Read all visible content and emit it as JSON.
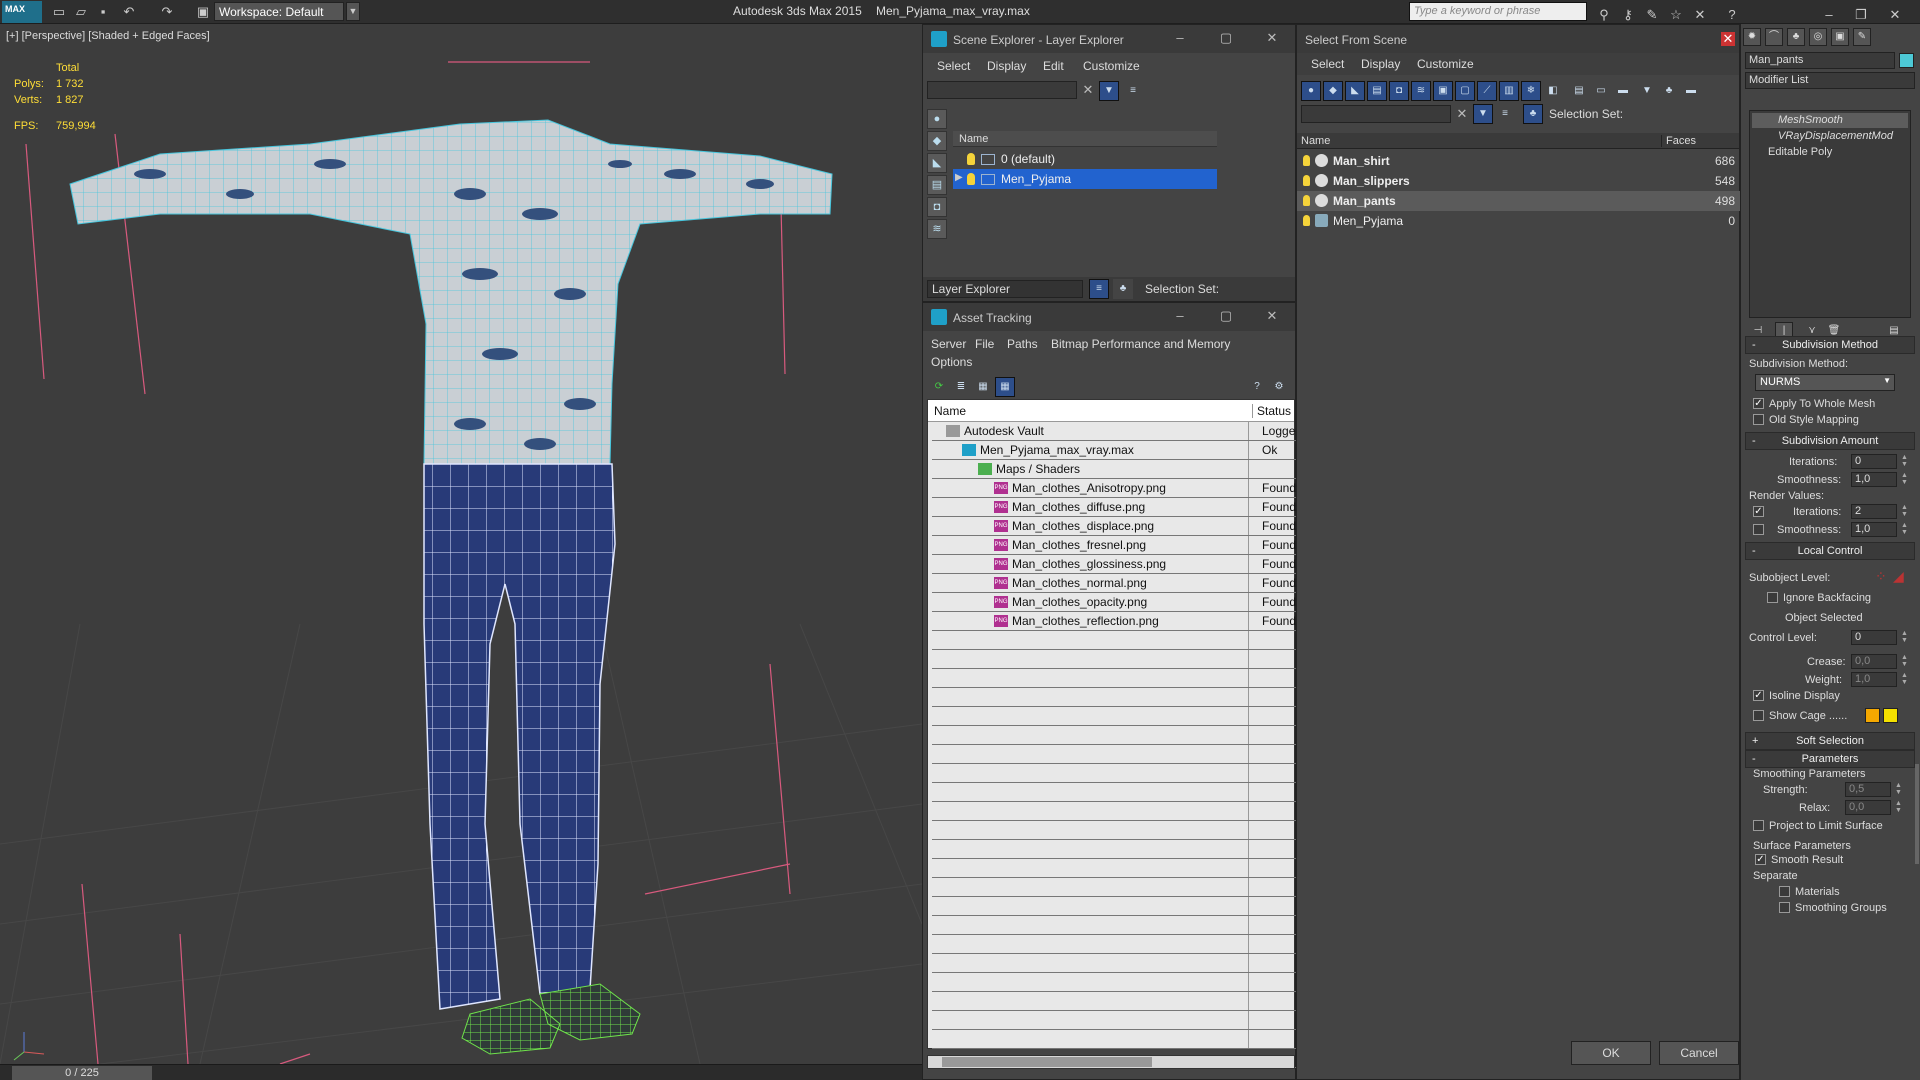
{
  "top_bar": {
    "workspace_label": "Workspace: Default",
    "app_title": "Autodesk 3ds Max  2015",
    "file_title": "Men_Pyjama_max_vray.max",
    "search_placeholder": "Type a keyword or phrase"
  },
  "viewport": {
    "label": "[+] [Perspective] [Shaded + Edged Faces]",
    "stats": {
      "total_label": "Total",
      "polys_label": "Polys:",
      "polys_value": "1 732",
      "verts_label": "Verts:",
      "verts_value": "1 827",
      "fps_label": "FPS:",
      "fps_value": "759,994"
    },
    "time_slider": "0 / 225"
  },
  "scene_explorer": {
    "title": "Scene Explorer - Layer Explorer",
    "menu": [
      "Select",
      "Display",
      "Edit",
      "Customize"
    ],
    "column_name": "Name",
    "layers": [
      {
        "name": "0 (default)",
        "selected": false
      },
      {
        "name": "Men_Pyjama",
        "selected": true
      }
    ],
    "footer_dropdown": "Layer Explorer",
    "selection_set_label": "Selection Set:"
  },
  "asset_tracking": {
    "title": "Asset Tracking",
    "menu": [
      "Server",
      "File",
      "Paths",
      "Bitmap Performance and Memory",
      "Options"
    ],
    "col_name": "Name",
    "col_status": "Status",
    "rows": [
      {
        "name": "Autodesk Vault",
        "status": "Logged",
        "indent": 0,
        "icon": "vault-icon"
      },
      {
        "name": "Men_Pyjama_max_vray.max",
        "status": "Ok",
        "indent": 1,
        "icon": "max-file-icon"
      },
      {
        "name": "Maps / Shaders",
        "status": "",
        "indent": 2,
        "icon": "maps-icon"
      },
      {
        "name": "Man_clothes_Anisotropy.png",
        "status": "Found",
        "indent": 3,
        "icon": "png-icon"
      },
      {
        "name": "Man_clothes_diffuse.png",
        "status": "Found",
        "indent": 3,
        "icon": "png-icon"
      },
      {
        "name": "Man_clothes_displace.png",
        "status": "Found",
        "indent": 3,
        "icon": "png-icon"
      },
      {
        "name": "Man_clothes_fresnel.png",
        "status": "Found",
        "indent": 3,
        "icon": "png-icon"
      },
      {
        "name": "Man_clothes_glossiness.png",
        "status": "Found",
        "indent": 3,
        "icon": "png-icon"
      },
      {
        "name": "Man_clothes_normal.png",
        "status": "Found",
        "indent": 3,
        "icon": "png-icon"
      },
      {
        "name": "Man_clothes_opacity.png",
        "status": "Found",
        "indent": 3,
        "icon": "png-icon"
      },
      {
        "name": "Man_clothes_reflection.png",
        "status": "Found",
        "indent": 3,
        "icon": "png-icon"
      }
    ]
  },
  "select_from_scene": {
    "title": "Select From Scene",
    "menu": [
      "Select",
      "Display",
      "Customize"
    ],
    "selection_set_label": "Selection Set:",
    "col_name": "Name",
    "col_faces": "Faces",
    "objects": [
      {
        "name": "Man_shirt",
        "faces": "686",
        "selected": false,
        "bold": true
      },
      {
        "name": "Man_slippers",
        "faces": "548",
        "selected": false,
        "bold": true
      },
      {
        "name": "Man_pants",
        "faces": "498",
        "selected": true,
        "bold": true
      },
      {
        "name": "Men_Pyjama",
        "faces": "0",
        "selected": false,
        "bold": false
      }
    ],
    "ok_label": "OK",
    "cancel_label": "Cancel"
  },
  "command_panel": {
    "object_name": "Man_pants",
    "object_color": "#4dc9d6",
    "modifier_list_label": "Modifier List",
    "modifier_stack": [
      "MeshSmooth",
      "VRayDisplacementMod",
      "Editable Poly"
    ],
    "subdivision_method": {
      "title": "Subdivision Method",
      "method_label": "Subdivision Method:",
      "method_value": "NURMS",
      "apply_whole_mesh": "Apply To Whole Mesh",
      "old_style_mapping": "Old Style Mapping"
    },
    "subdivision_amount": {
      "title": "Subdivision Amount",
      "iterations_label": "Iterations:",
      "iterations_value": "0",
      "smoothness_label": "Smoothness:",
      "smoothness_value": "1,0",
      "render_values_label": "Render Values:",
      "render_iterations_label": "Iterations:",
      "render_iterations_value": "2",
      "render_smoothness_label": "Smoothness:",
      "render_smoothness_value": "1,0"
    },
    "local_control": {
      "title": "Local Control",
      "subobject_label": "Subobject Level:",
      "ignore_backfacing": "Ignore Backfacing",
      "object_selected": "Object Selected",
      "control_level_label": "Control Level:",
      "control_level_value": "0",
      "crease_label": "Crease:",
      "crease_value": "0,0",
      "weight_label": "Weight:",
      "weight_value": "1,0",
      "isoline_display": "Isoline Display",
      "show_cage": "Show Cage ......",
      "cage_color_1": "#f5a800",
      "cage_color_2": "#f5e100"
    },
    "soft_selection": {
      "title": "Soft Selection"
    },
    "parameters": {
      "title": "Parameters",
      "smoothing_parameters": "Smoothing Parameters",
      "strength_label": "Strength:",
      "strength_value": "0,5",
      "relax_label": "Relax:",
      "relax_value": "0,0",
      "project_limit": "Project to Limit Surface",
      "surface_parameters": "Surface Parameters",
      "smooth_result": "Smooth Result",
      "separate_label": "Separate",
      "materials": "Materials",
      "smoothing_groups": "Smoothing Groups"
    }
  }
}
